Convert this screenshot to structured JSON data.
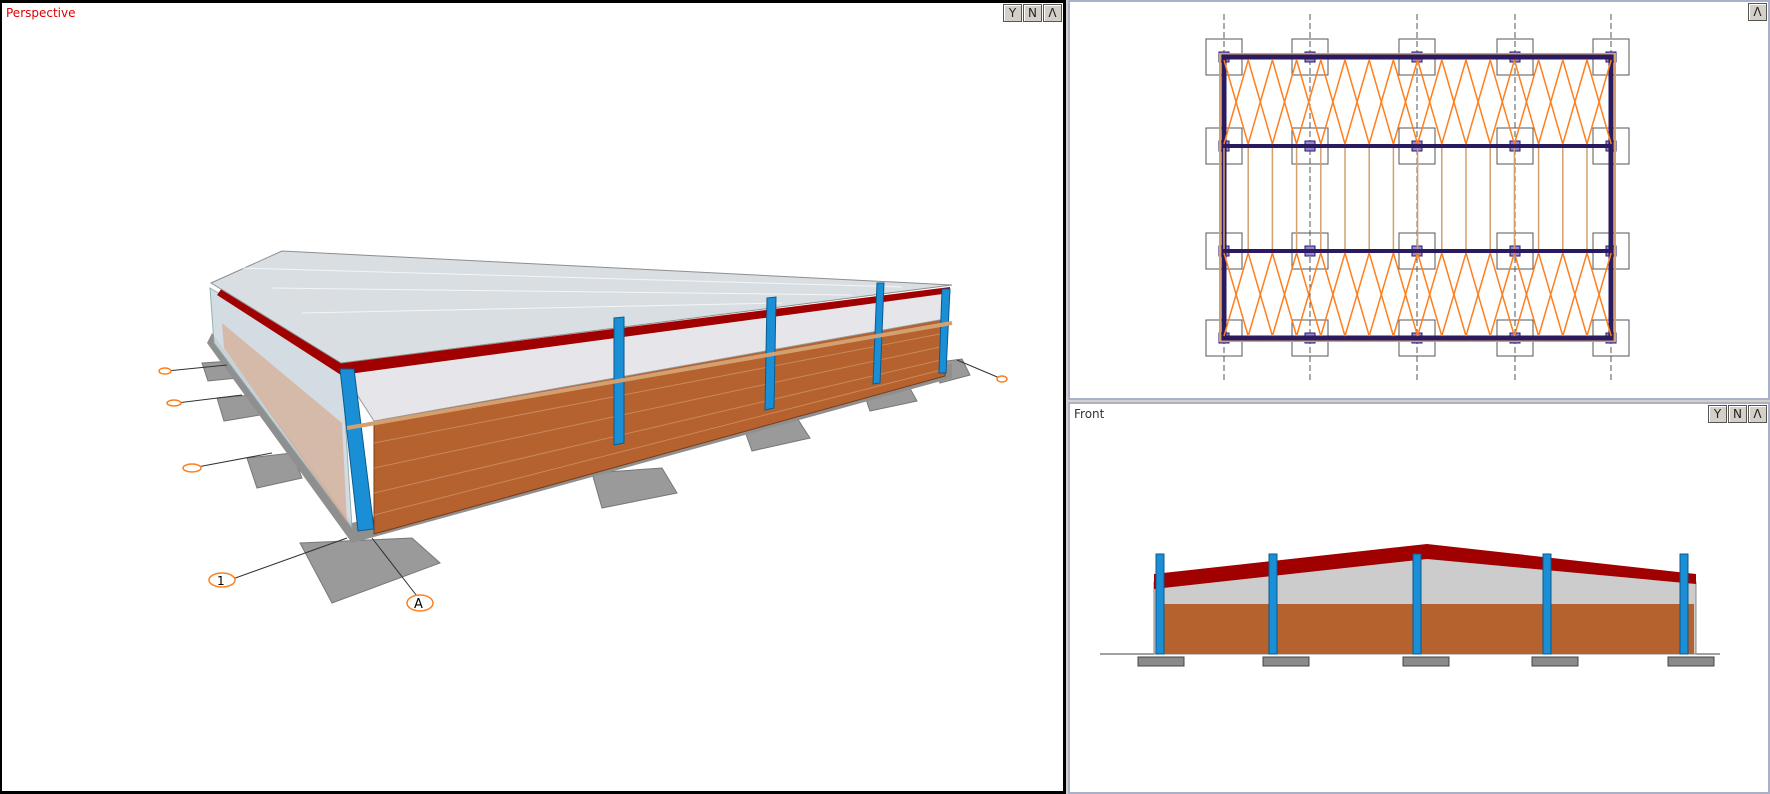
{
  "views": {
    "perspective": {
      "label": "Perspective",
      "grid_labels": [
        "1",
        "A"
      ]
    },
    "plan": {
      "label": ""
    },
    "front": {
      "label": "Front"
    }
  },
  "view_buttons": [
    "Y",
    "N",
    "Λ"
  ],
  "colors": {
    "active_view_label": "#e00000",
    "column": "#1b8fd6",
    "roof_red": "#a00000",
    "brick": "#b5622e",
    "bracing": "#ff7f1e",
    "frame": "#2a1a60",
    "footing": "#9a9a9a"
  }
}
